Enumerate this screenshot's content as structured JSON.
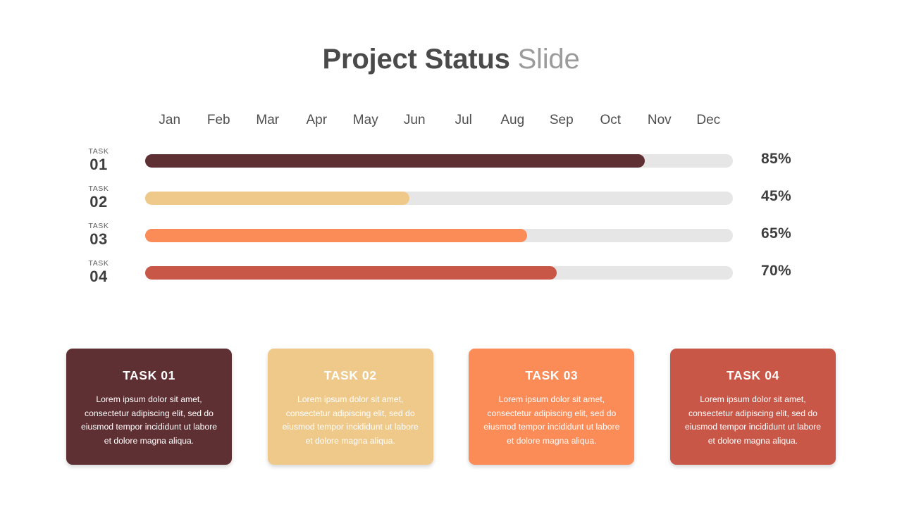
{
  "header": {
    "title_main": "Project Status",
    "title_accent": "Slide"
  },
  "chart_data": {
    "type": "bar",
    "title": "Project Status Slide",
    "orientation": "horizontal",
    "xlabel": "",
    "ylabel": "",
    "xlim": [
      0,
      100
    ],
    "grid": false,
    "legend": null,
    "axis_tick_labels": [
      "Jan",
      "Feb",
      "Mar",
      "Apr",
      "May",
      "Jun",
      "Jul",
      "Aug",
      "Sep",
      "Oct",
      "Nov",
      "Dec"
    ],
    "categories": [
      "TASK 01",
      "TASK 02",
      "TASK 03",
      "TASK 04"
    ],
    "values": [
      85,
      45,
      65,
      70
    ],
    "value_labels": [
      "85%",
      "45%",
      "65%",
      "70%"
    ],
    "colors": [
      "#5E2F33",
      "#EFC98A",
      "#FB8B57",
      "#C85748"
    ],
    "track_color": "#E6E6E6"
  },
  "timeline": {
    "months": [
      {
        "label": "Jan"
      },
      {
        "label": "Feb"
      },
      {
        "label": "Mar"
      },
      {
        "label": "Apr"
      },
      {
        "label": "May"
      },
      {
        "label": "Jun"
      },
      {
        "label": "Jul"
      },
      {
        "label": "Aug"
      },
      {
        "label": "Sep"
      },
      {
        "label": "Oct"
      },
      {
        "label": "Nov"
      },
      {
        "label": "Dec"
      }
    ],
    "rows": [
      {
        "kicker": "TASK",
        "number": "01",
        "percent_label": "85%",
        "percent_value": 85,
        "color": "#5E2F33"
      },
      {
        "kicker": "TASK",
        "number": "02",
        "percent_label": "45%",
        "percent_value": 45,
        "color": "#EFC98A"
      },
      {
        "kicker": "TASK",
        "number": "03",
        "percent_label": "65%",
        "percent_value": 65,
        "color": "#FB8B57"
      },
      {
        "kicker": "TASK",
        "number": "04",
        "percent_label": "70%",
        "percent_value": 70,
        "color": "#C85748"
      }
    ]
  },
  "cards": [
    {
      "title": "TASK 01",
      "body": "Lorem ipsum dolor sit amet, consectetur adipiscing elit, sed do eiusmod tempor incididunt ut labore et dolore magna aliqua.",
      "bg": "#5E2F33"
    },
    {
      "title": "TASK 02",
      "body": "Lorem ipsum dolor sit amet, consectetur adipiscing elit, sed do eiusmod tempor incididunt ut labore et dolore magna aliqua.",
      "bg": "#EFC98A"
    },
    {
      "title": "TASK 03",
      "body": "Lorem ipsum dolor sit amet, consectetur adipiscing elit, sed do eiusmod tempor incididunt ut labore et dolore magna aliqua.",
      "bg": "#FB8B57"
    },
    {
      "title": "TASK 04",
      "body": "Lorem ipsum dolor sit amet, consectetur adipiscing elit, sed do eiusmod tempor incididunt ut labore et dolore magna aliqua.",
      "bg": "#C85748"
    }
  ]
}
